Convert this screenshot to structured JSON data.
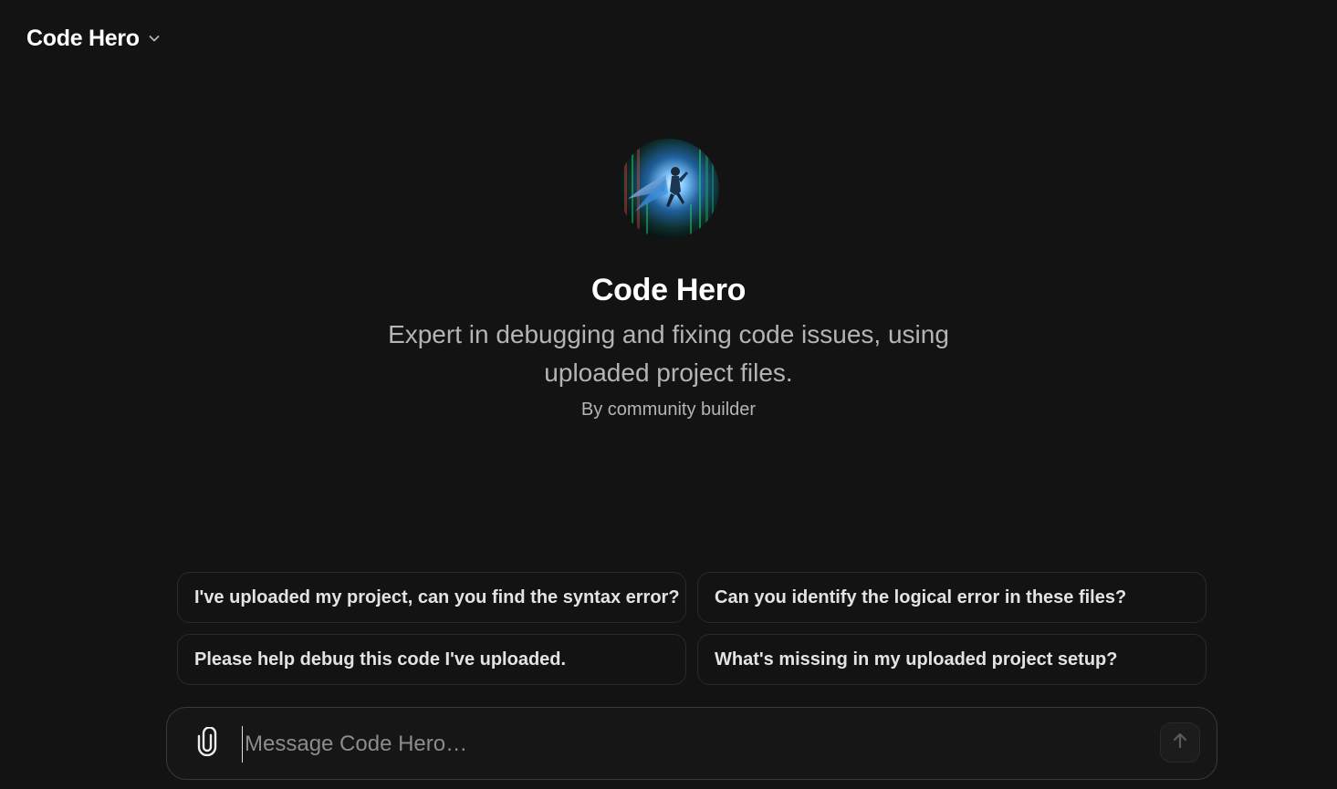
{
  "header": {
    "model_name": "Code Hero",
    "chevron_icon": "chevron-down-icon"
  },
  "gpt": {
    "name": "Code Hero",
    "description": "Expert in debugging and fixing code issues, using uploaded project files.",
    "author": "By community builder",
    "avatar_icon": "superhero-avatar-image"
  },
  "starters": [
    {
      "label": "I've uploaded my project, can you find the syntax error?"
    },
    {
      "label": "Can you identify the logical error in these files?"
    },
    {
      "label": "Please help debug this code I've uploaded."
    },
    {
      "label": "What's missing in my uploaded project setup?"
    }
  ],
  "composer": {
    "placeholder": "Message Code Hero…",
    "value": "",
    "attach_icon": "paperclip-icon",
    "send_icon": "arrow-up-icon"
  },
  "colors": {
    "background": "#131313",
    "text_primary": "#ffffff",
    "text_secondary": "#b4b4b4",
    "border": "#2a2a2a"
  }
}
